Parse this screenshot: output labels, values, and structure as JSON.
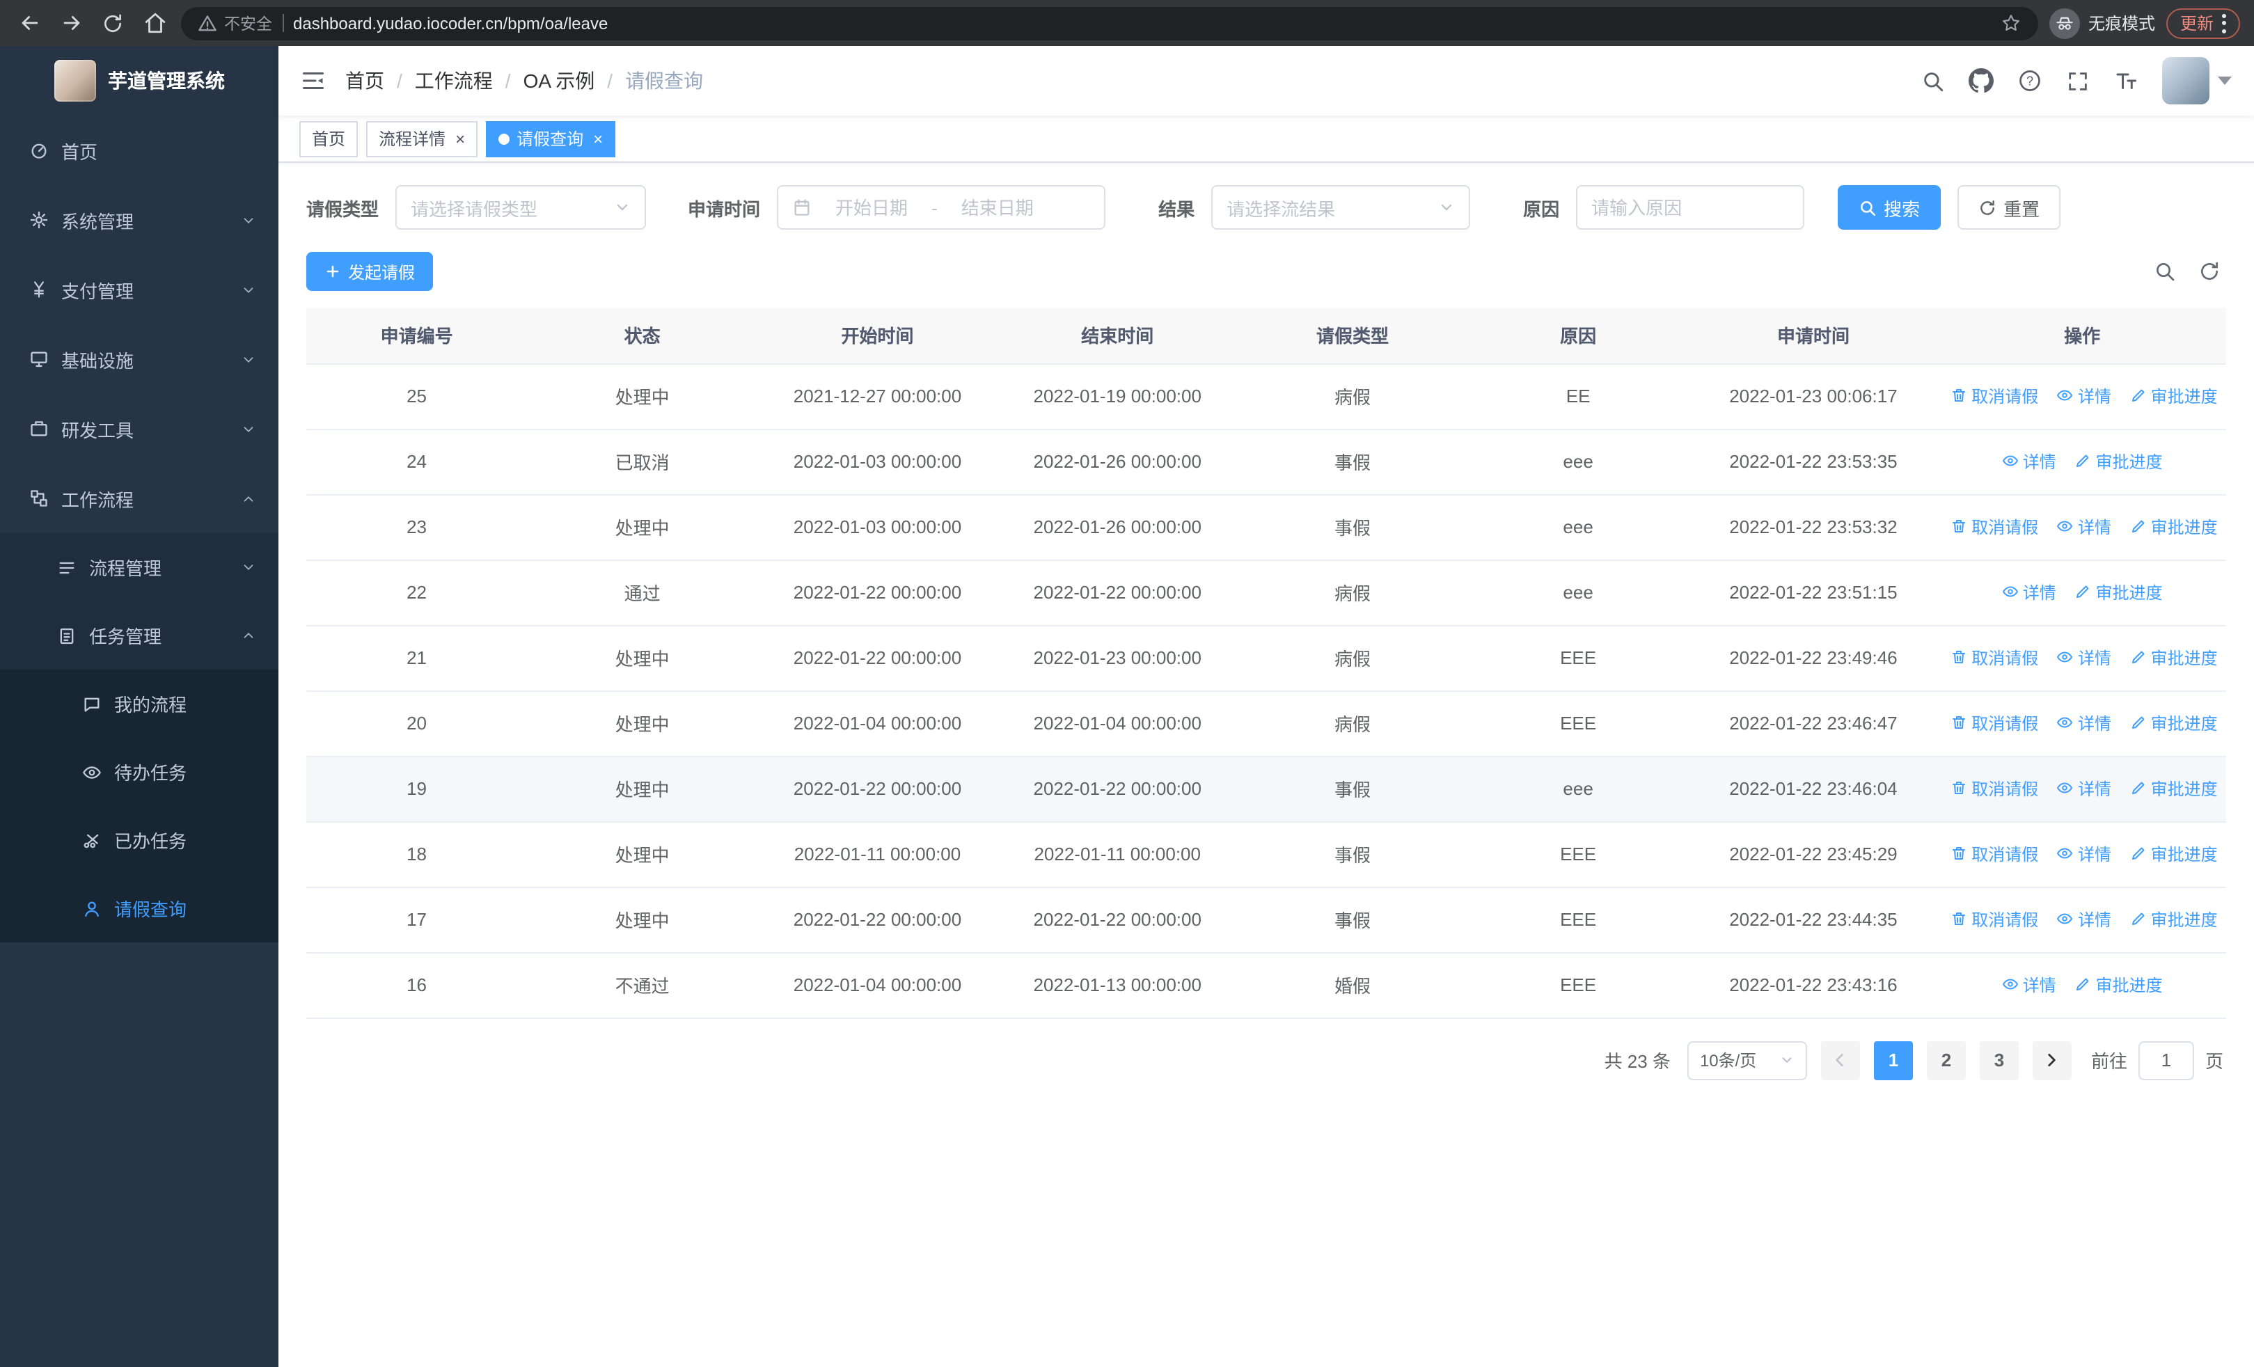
{
  "browser": {
    "security_label": "不安全",
    "url": "dashboard.yudao.iocoder.cn/bpm/oa/leave",
    "incognito_label": "无痕模式",
    "update_label": "更新"
  },
  "app_title": "芋道管理系统",
  "sidebar": {
    "items": [
      {
        "label": "首页",
        "icon": "home-icon",
        "level": 1
      },
      {
        "label": "系统管理",
        "icon": "gear-icon",
        "level": 1,
        "arrow": "down"
      },
      {
        "label": "支付管理",
        "icon": "payment-icon",
        "level": 1,
        "arrow": "down"
      },
      {
        "label": "基础设施",
        "icon": "infrastructure-icon",
        "level": 1,
        "arrow": "down"
      },
      {
        "label": "研发工具",
        "icon": "devtools-icon",
        "level": 1,
        "arrow": "down"
      },
      {
        "label": "工作流程",
        "icon": "workflow-icon",
        "level": 1,
        "arrow": "up"
      },
      {
        "label": "流程管理",
        "icon": "process-icon",
        "level": 2,
        "arrow": "down"
      },
      {
        "label": "任务管理",
        "icon": "task-icon",
        "level": 2,
        "arrow": "up"
      },
      {
        "label": "我的流程",
        "icon": "my-process-icon",
        "level": 3
      },
      {
        "label": "待办任务",
        "icon": "todo-icon",
        "level": 3
      },
      {
        "label": "已办任务",
        "icon": "done-icon",
        "level": 3
      },
      {
        "label": "请假查询",
        "icon": "leave-icon",
        "level": 3,
        "active": true
      }
    ]
  },
  "header": {
    "breadcrumb": [
      "首页",
      "工作流程",
      "OA 示例",
      "请假查询"
    ]
  },
  "tabs": [
    {
      "label": "首页",
      "active": false,
      "closable": false
    },
    {
      "label": "流程详情",
      "active": false,
      "closable": true
    },
    {
      "label": "请假查询",
      "active": true,
      "closable": true
    }
  ],
  "filters": {
    "leave_type_label": "请假类型",
    "leave_type_placeholder": "请选择请假类型",
    "apply_time_label": "申请时间",
    "start_date_placeholder": "开始日期",
    "date_separator": "-",
    "end_date_placeholder": "结束日期",
    "result_label": "结果",
    "result_placeholder": "请选择流结果",
    "reason_label": "原因",
    "reason_placeholder": "请输入原因",
    "search_label": "搜索",
    "reset_label": "重置"
  },
  "toolbar": {
    "create_label": "发起请假"
  },
  "table": {
    "columns": [
      "申请编号",
      "状态",
      "开始时间",
      "结束时间",
      "请假类型",
      "原因",
      "申请时间",
      "操作"
    ],
    "actions": {
      "cancel": "取消请假",
      "detail": "详情",
      "progress": "审批进度"
    },
    "rows": [
      {
        "id": "25",
        "status": "处理中",
        "start": "2021-12-27 00:00:00",
        "end": "2022-01-19 00:00:00",
        "type": "病假",
        "reason": "EE",
        "apply_time": "2022-01-23 00:06:17",
        "cancellable": true
      },
      {
        "id": "24",
        "status": "已取消",
        "start": "2022-01-03 00:00:00",
        "end": "2022-01-26 00:00:00",
        "type": "事假",
        "reason": "eee",
        "apply_time": "2022-01-22 23:53:35",
        "cancellable": false
      },
      {
        "id": "23",
        "status": "处理中",
        "start": "2022-01-03 00:00:00",
        "end": "2022-01-26 00:00:00",
        "type": "事假",
        "reason": "eee",
        "apply_time": "2022-01-22 23:53:32",
        "cancellable": true
      },
      {
        "id": "22",
        "status": "通过",
        "start": "2022-01-22 00:00:00",
        "end": "2022-01-22 00:00:00",
        "type": "病假",
        "reason": "eee",
        "apply_time": "2022-01-22 23:51:15",
        "cancellable": false
      },
      {
        "id": "21",
        "status": "处理中",
        "start": "2022-01-22 00:00:00",
        "end": "2022-01-23 00:00:00",
        "type": "病假",
        "reason": "EEE",
        "apply_time": "2022-01-22 23:49:46",
        "cancellable": true
      },
      {
        "id": "20",
        "status": "处理中",
        "start": "2022-01-04 00:00:00",
        "end": "2022-01-04 00:00:00",
        "type": "病假",
        "reason": "EEE",
        "apply_time": "2022-01-22 23:46:47",
        "cancellable": true
      },
      {
        "id": "19",
        "status": "处理中",
        "start": "2022-01-22 00:00:00",
        "end": "2022-01-22 00:00:00",
        "type": "事假",
        "reason": "eee",
        "apply_time": "2022-01-22 23:46:04",
        "cancellable": true,
        "highlighted": true
      },
      {
        "id": "18",
        "status": "处理中",
        "start": "2022-01-11 00:00:00",
        "end": "2022-01-11 00:00:00",
        "type": "事假",
        "reason": "EEE",
        "apply_time": "2022-01-22 23:45:29",
        "cancellable": true
      },
      {
        "id": "17",
        "status": "处理中",
        "start": "2022-01-22 00:00:00",
        "end": "2022-01-22 00:00:00",
        "type": "事假",
        "reason": "EEE",
        "apply_time": "2022-01-22 23:44:35",
        "cancellable": true
      },
      {
        "id": "16",
        "status": "不通过",
        "start": "2022-01-04 00:00:00",
        "end": "2022-01-13 00:00:00",
        "type": "婚假",
        "reason": "EEE",
        "apply_time": "2022-01-22 23:43:16",
        "cancellable": false
      }
    ]
  },
  "pagination": {
    "total_label": "共 23 条",
    "page_size_label": "10条/页",
    "pages": [
      "1",
      "2",
      "3"
    ],
    "active_page": "1",
    "goto_prefix": "前往",
    "goto_value": "1",
    "goto_suffix": "页"
  },
  "colors": {
    "accent": "#409eff",
    "sidebar_bg": "#263445",
    "update_text": "#f28b82"
  }
}
